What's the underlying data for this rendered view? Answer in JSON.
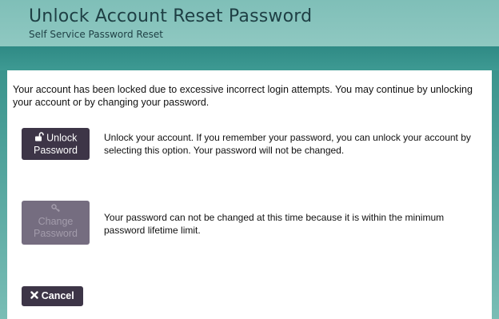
{
  "header": {
    "title": "Unlock Account Reset Password",
    "subtitle": "Self Service Password Reset"
  },
  "notice": "Your account has been locked due to excessive incorrect login attempts. You may continue by unlocking your account or by changing your password.",
  "options": {
    "unlock": {
      "label_line1": "Unlock",
      "label_line2": "Password",
      "icon": "unlock-icon",
      "description": "Unlock your account. If you remember your password, you can unlock your account by selecting this option. Your password will not be changed."
    },
    "change": {
      "label_line1": "Change",
      "label_line2": "Password",
      "icon": "key-icon",
      "disabled": true,
      "description": "Your password can not be changed at this time because it is within the minimum password lifetime limit."
    }
  },
  "cancel": {
    "label": "Cancel",
    "icon": "close-icon"
  },
  "colors": {
    "header_bg": "#8fc8c1",
    "band_bg": "#2f8a85",
    "button_bg": "#3d3547",
    "button_disabled_bg": "#756d80",
    "title_text": "#1e3f44"
  }
}
